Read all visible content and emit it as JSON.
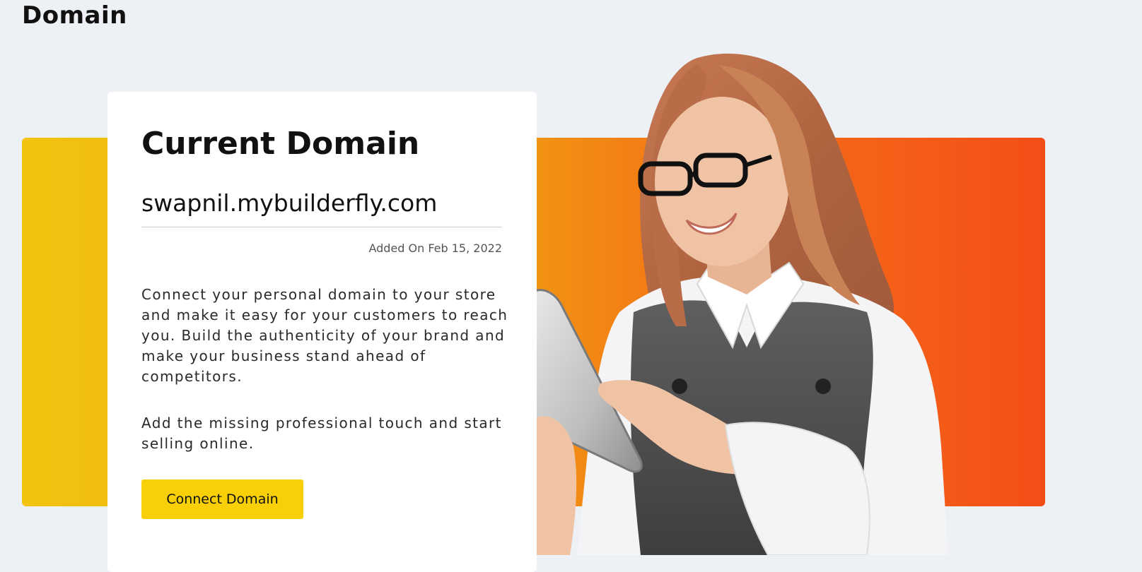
{
  "page": {
    "heading": "Domain"
  },
  "card": {
    "title": "Current Domain",
    "domain": "swapnil.mybuilderfly.com",
    "added_on": "Added On Feb 15, 2022",
    "description_1": "Connect your personal domain to your store and make it easy for your customers to reach you. Build the authenticity of your brand and make your business stand ahead of competitors.",
    "description_2": "Add the missing professional touch and start selling online.",
    "button_label": "Connect Domain"
  },
  "colors": {
    "background": "#edf0f4",
    "banner_start": "#f2c311",
    "banner_end": "#f44e17",
    "button": "#f9d008"
  },
  "hero": {
    "icon": "woman-with-tablet-illustration"
  }
}
